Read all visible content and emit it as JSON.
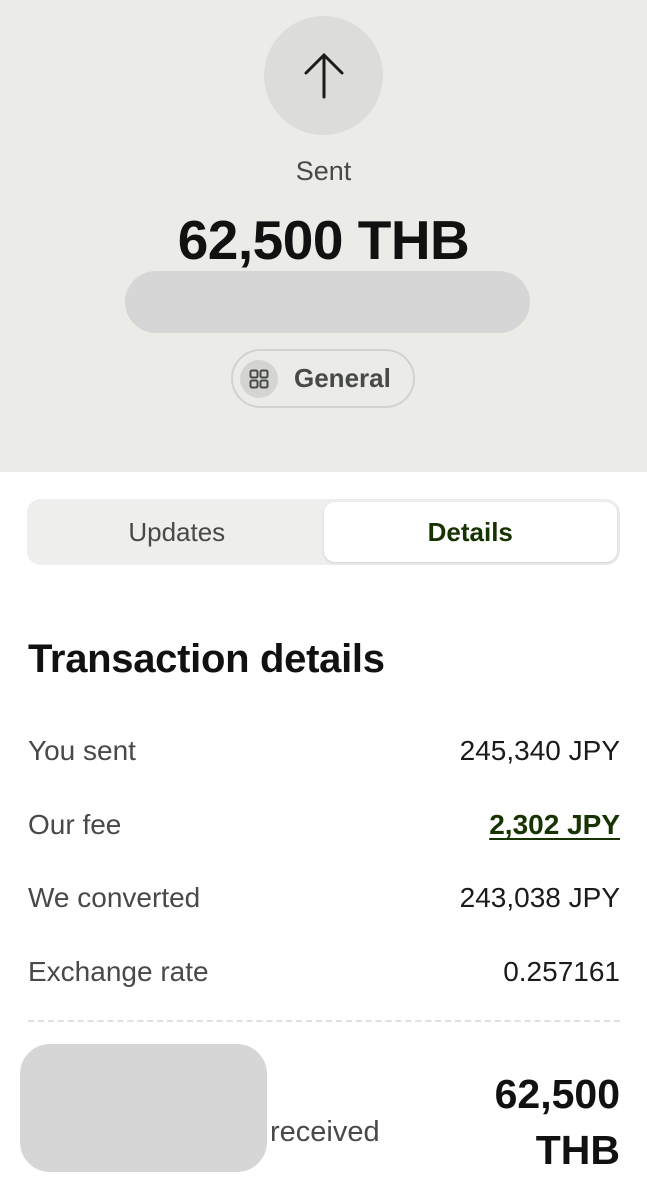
{
  "header": {
    "direction_icon": "arrow-up-icon",
    "status": "Sent",
    "amount": "62,500 THB",
    "category": {
      "icon": "grid-icon",
      "label": "General"
    }
  },
  "tabs": [
    {
      "label": "Updates",
      "active": false
    },
    {
      "label": "Details",
      "active": true
    }
  ],
  "details": {
    "title": "Transaction details",
    "rows": [
      {
        "label": "You sent",
        "value": "245,340 JPY"
      },
      {
        "label": "Our fee",
        "value": "2,302 JPY"
      },
      {
        "label": "We converted",
        "value": "243,038 JPY"
      },
      {
        "label": "Exchange rate",
        "value": "0.257161"
      }
    ],
    "received_label": "received",
    "received_amount_line1": "62,500",
    "received_amount_line2": "THB"
  },
  "colors": {
    "header_bg": "#ebece8",
    "accent_green": "#163300"
  }
}
